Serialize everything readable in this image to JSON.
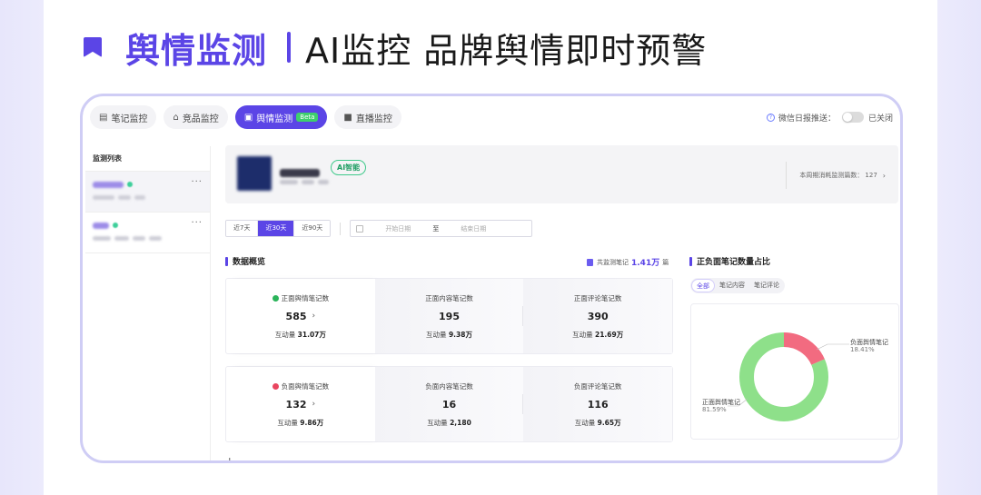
{
  "hero": {
    "title": "舆情监测",
    "subtitle": "AI监控 品牌舆情即时预警"
  },
  "colors": {
    "accent": "#5b45e6",
    "positive": "#8ee08a",
    "negative": "#f26b80"
  },
  "tabs": [
    {
      "label": "笔记监控",
      "icon": "note-icon"
    },
    {
      "label": "竞品监控",
      "icon": "shop-icon"
    },
    {
      "label": "舆情监测",
      "icon": "chat-icon",
      "badge": "Beta",
      "active": true
    },
    {
      "label": "直播监控",
      "icon": "video-icon"
    }
  ],
  "wechat": {
    "label": "微信日报推送：",
    "state": "已关闭"
  },
  "sidebar": {
    "title": "监测列表"
  },
  "brand": {
    "ai_badge": "AI智能",
    "quota_label": "本周期消耗监测篇数：",
    "quota_value": "127"
  },
  "filters": {
    "ranges": [
      "近7天",
      "近30天",
      "近90天"
    ],
    "active_range": "近30天",
    "start_placeholder": "开始日期",
    "to": "至",
    "end_placeholder": "结束日期"
  },
  "overview": {
    "title": "数据概览",
    "total_label": "共监测笔记",
    "total_value": "1.41万",
    "total_unit": "篇",
    "engagement_label": "互动量",
    "positive": [
      {
        "label": "正面舆情笔记数",
        "value": "585",
        "engagement": "31.07万"
      },
      {
        "label": "正面内容笔记数",
        "value": "195",
        "engagement": "9.38万"
      },
      {
        "label": "正面评论笔记数",
        "value": "390",
        "engagement": "21.69万"
      }
    ],
    "negative": [
      {
        "label": "负面舆情笔记数",
        "value": "132",
        "engagement": "9.86万"
      },
      {
        "label": "负面内容笔记数",
        "value": "16",
        "engagement": "2,180"
      },
      {
        "label": "负面评论笔记数",
        "value": "116",
        "engagement": "9.65万"
      }
    ]
  },
  "ratio": {
    "title": "正负面笔记数量占比",
    "tabs": [
      "全部",
      "笔记内容",
      "笔记评论"
    ],
    "active_tab": "全部"
  },
  "chart_data": {
    "type": "pie",
    "donut": true,
    "title": "正负面笔记数量占比",
    "categories": [
      "负面舆情笔记",
      "正面舆情笔记"
    ],
    "values": [
      18.41,
      81.59
    ],
    "labels": [
      "18.41%",
      "81.59%"
    ],
    "colors": [
      "#f26b80",
      "#8ee08a"
    ]
  }
}
